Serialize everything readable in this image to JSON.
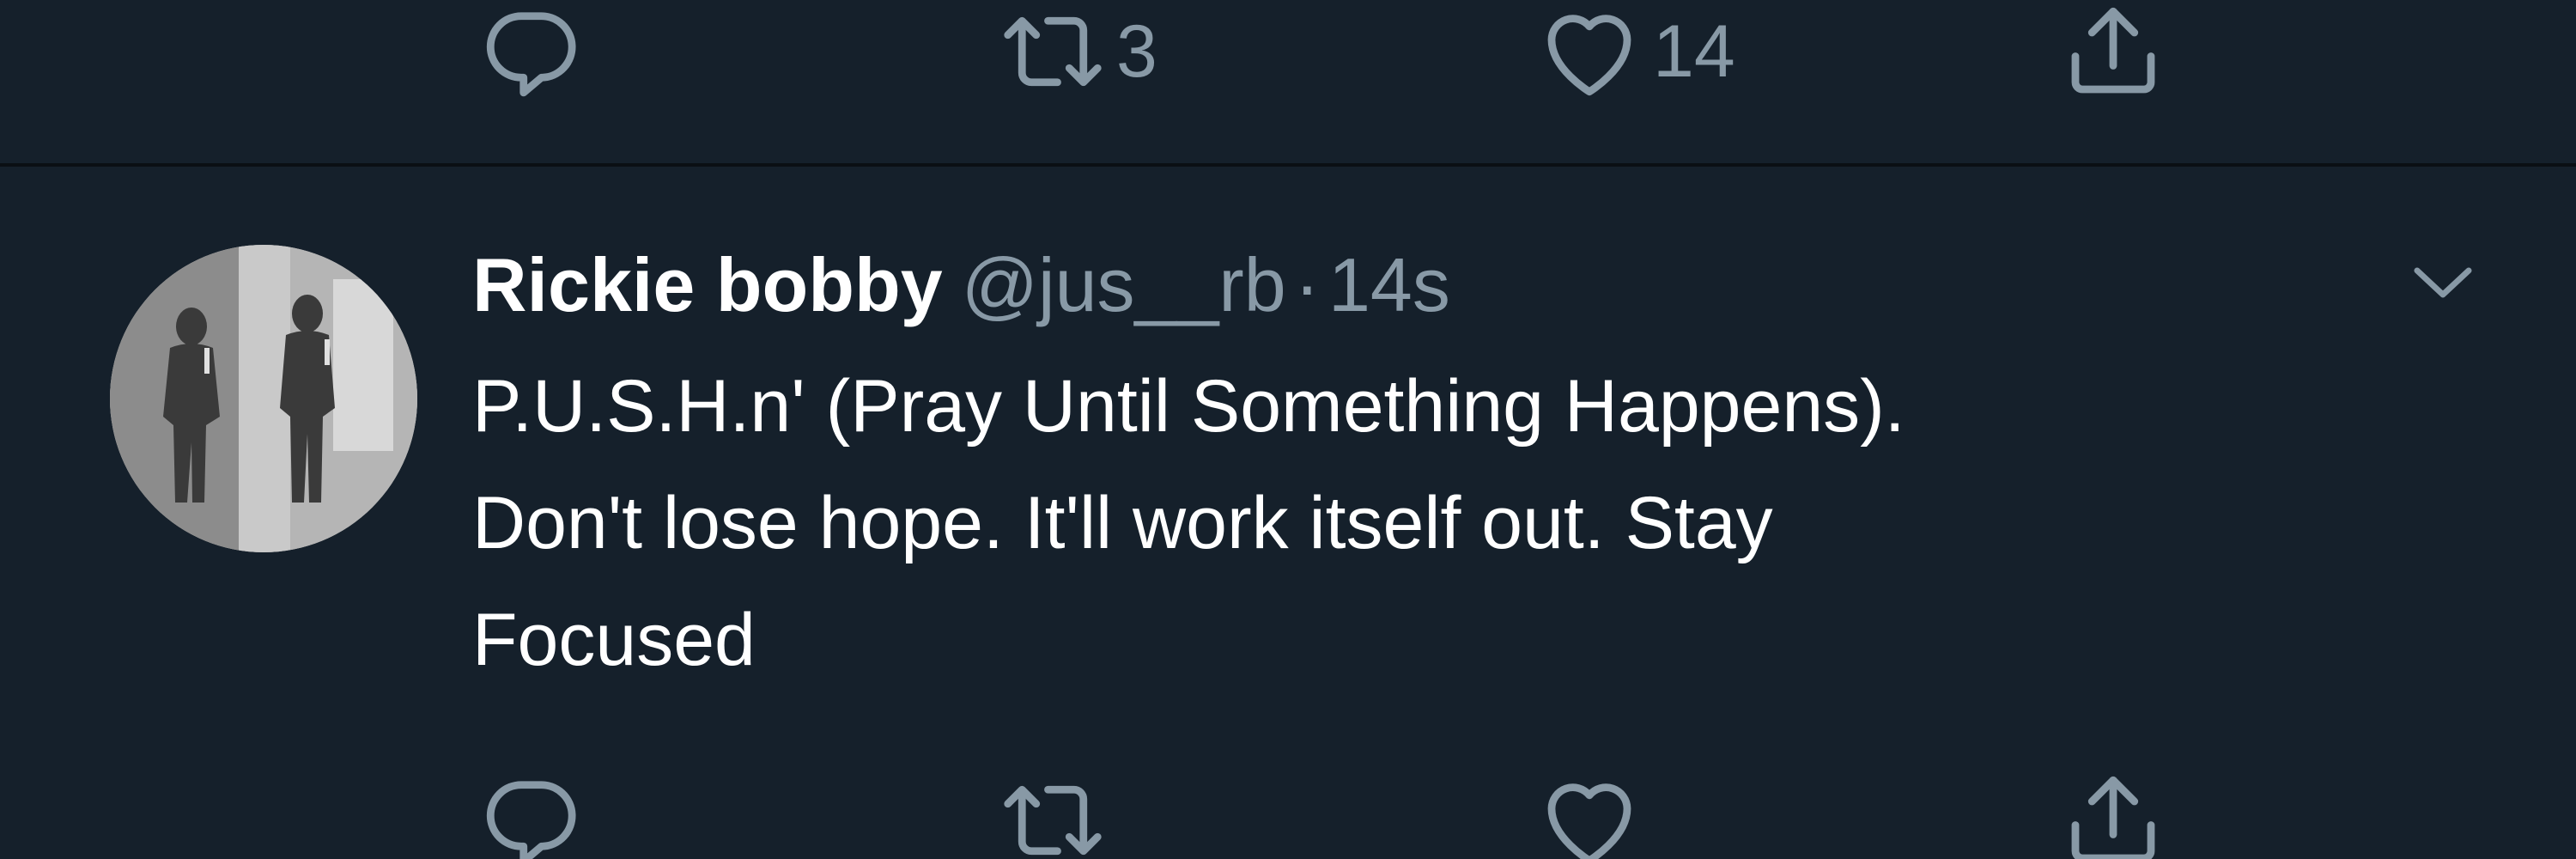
{
  "previous_tweet": {
    "actions": {
      "reply_count": "",
      "retweet_count": "3",
      "like_count": "14"
    },
    "icons": [
      "reply-icon",
      "retweet-icon",
      "like-icon",
      "share-icon"
    ]
  },
  "tweet": {
    "display_name": "Rickie bobby",
    "handle": "@jus__rb",
    "separator": "·",
    "timestamp": "14s",
    "text_lines": [
      "P.U.S.H.n' (Pray Until Something Happens).",
      "Don't lose hope. It'll work itself out. Stay",
      "Focused"
    ],
    "avatar_icon": "avatar-photo",
    "menu_icon": "chevron-down-icon",
    "actions": {
      "reply_count": "",
      "retweet_count": "",
      "like_count": ""
    }
  },
  "colors": {
    "background": "#15202b",
    "text_primary": "#ffffff",
    "text_secondary": "#8899a6",
    "divider": "#0a0f14"
  }
}
